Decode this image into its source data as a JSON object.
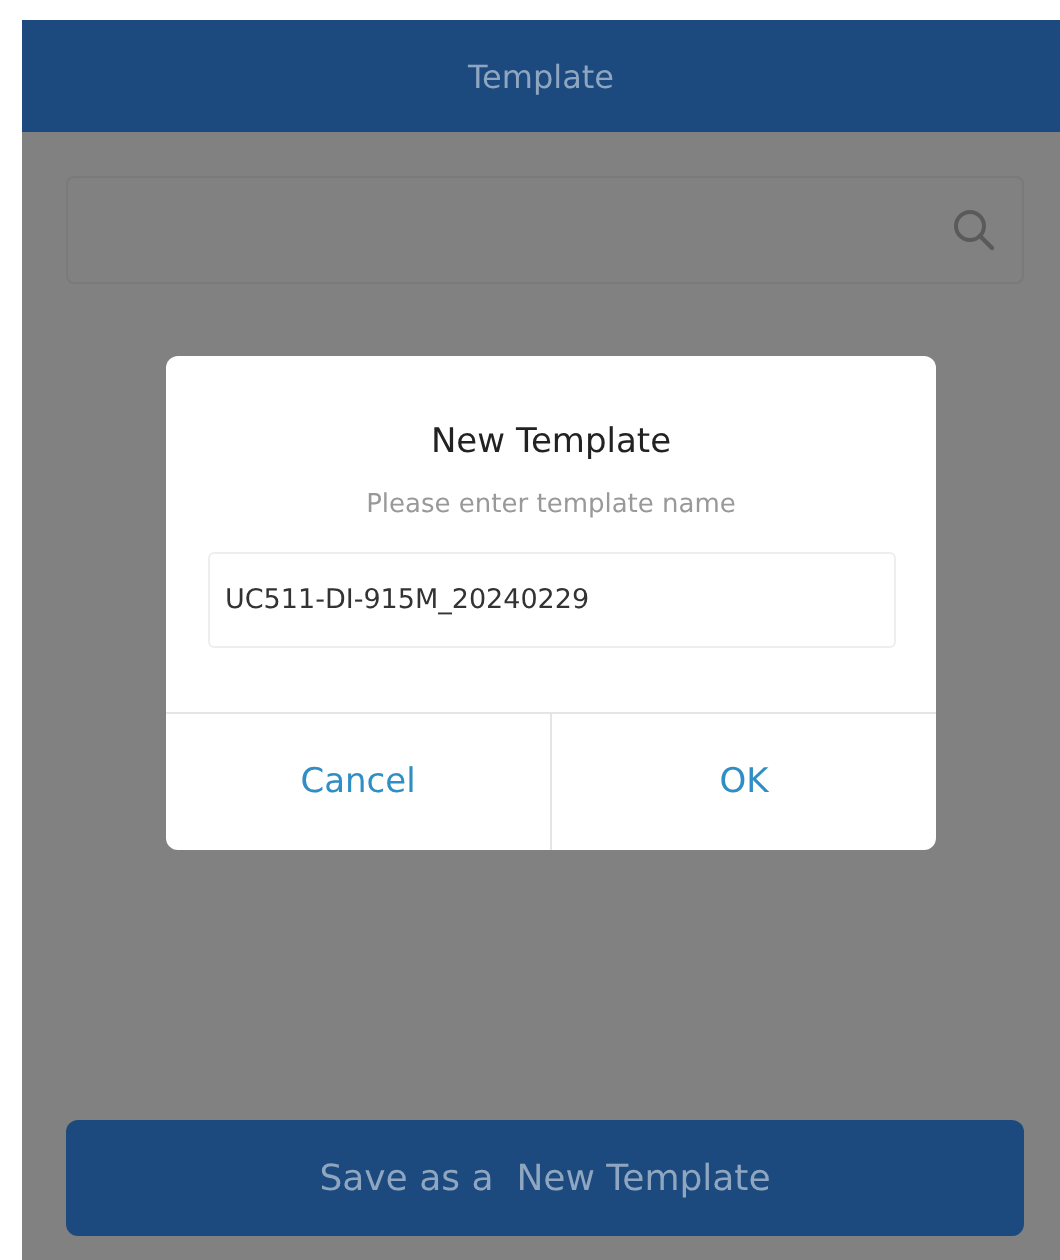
{
  "header": {
    "title": "Template"
  },
  "search": {
    "kind": "search"
  },
  "dialog": {
    "title": "New Template",
    "prompt": "Please enter template name",
    "value": "UC511-DI-915M_20240229",
    "buttons": [
      "Cancel",
      "OK"
    ]
  },
  "save_button": {
    "label": "Save as a  New Template"
  }
}
